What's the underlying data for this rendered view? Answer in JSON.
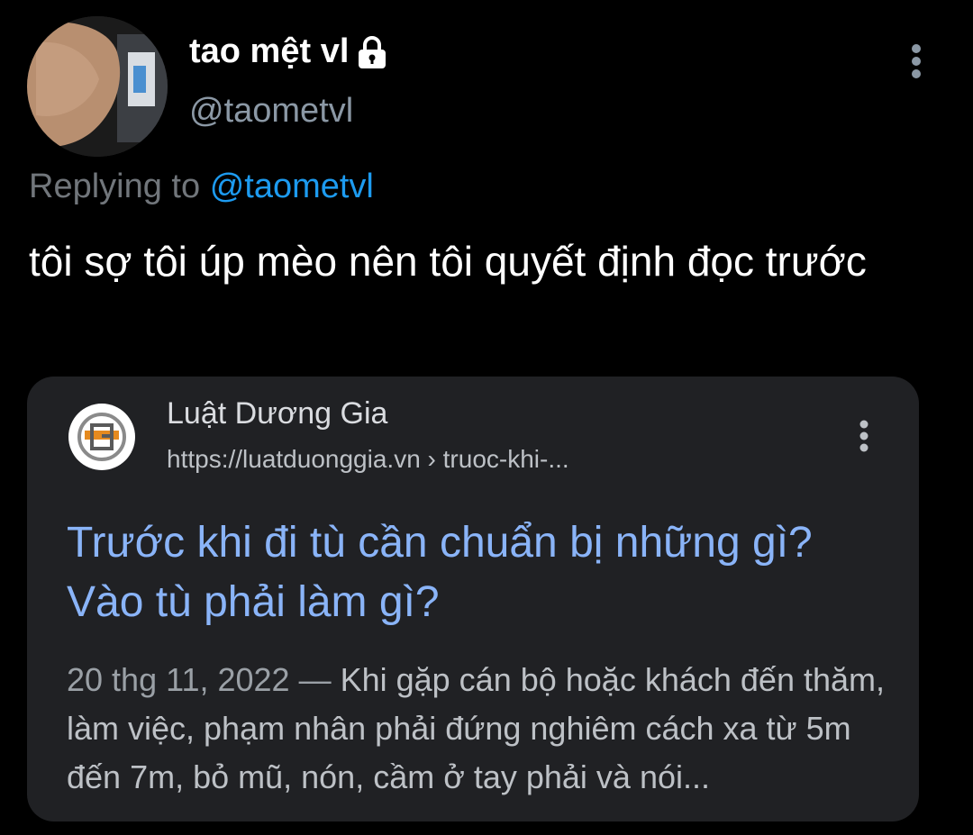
{
  "tweet": {
    "author": {
      "display_name": "tao mệt vl",
      "handle": "@taometvl",
      "protected_icon": "lock-icon",
      "avatar_icon": "avatar"
    },
    "more_icon": "more-vertical-icon",
    "replying": {
      "prefix": "Replying to",
      "mention": "@taometvl"
    },
    "text": "tôi sợ tôi úp mèo nên tôi quyết định đọc trước"
  },
  "card": {
    "site_name": "Luật Dương Gia",
    "url": "https://luatduonggia.vn › truoc-khi-...",
    "favicon_icon": "site-logo-icon",
    "more_icon": "more-vertical-icon",
    "title": "Trước khi đi tù cần chuẩn bị những gì? Vào tù phải làm gì?",
    "date": "20 thg 11, 2022",
    "separator": " — ",
    "snippet": "Khi gặp cán bộ hoặc khách đến thăm, làm việc, phạm nhân phải đứng nghiêm cách xa từ 5m đến 7m, bỏ mũ, nón, cầm ở tay phải và nói..."
  },
  "colors": {
    "background": "#000000",
    "card_background": "#202124",
    "mention_blue": "#1d9bf0",
    "link_title": "#8ab4f8",
    "muted_text": "#71767b"
  }
}
